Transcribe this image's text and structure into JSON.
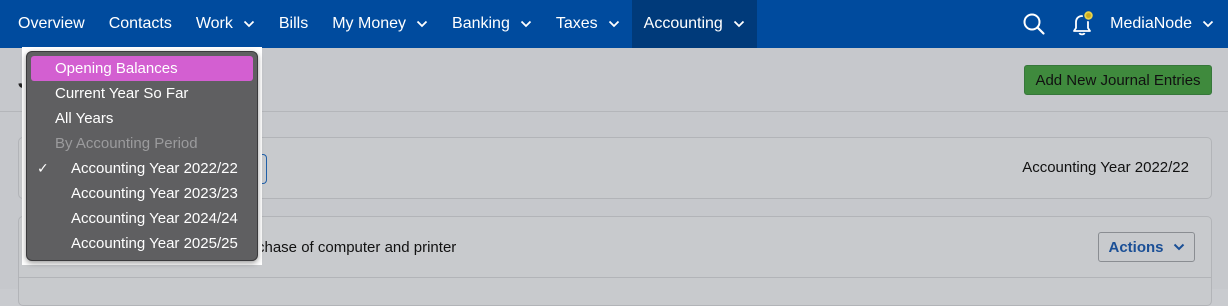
{
  "nav": {
    "items": [
      {
        "label": "Overview",
        "has_caret": false
      },
      {
        "label": "Contacts",
        "has_caret": false
      },
      {
        "label": "Work",
        "has_caret": true
      },
      {
        "label": "Bills",
        "has_caret": false
      },
      {
        "label": "My Money",
        "has_caret": true
      },
      {
        "label": "Banking",
        "has_caret": true
      },
      {
        "label": "Taxes",
        "has_caret": true
      },
      {
        "label": "Accounting",
        "has_caret": true,
        "active": true
      }
    ],
    "search_icon": "search-icon",
    "notification_icon": "bell-icon",
    "user_label": "MediaNode"
  },
  "page": {
    "title_fragment": "J",
    "add_button_label": "Add New Journal Entries",
    "period_display": "Accounting Year 2022/22",
    "entry_description_fragment": "chase of computer and printer",
    "actions_label": "Actions"
  },
  "menu": {
    "items": [
      {
        "label": "Opening Balances",
        "selected": true
      },
      {
        "label": "Current Year So Far"
      },
      {
        "label": "All Years"
      },
      {
        "label": "By Accounting Period",
        "disabled": true
      },
      {
        "label": "Accounting Year 2022/22",
        "checked": true,
        "indent": true
      },
      {
        "label": "Accounting Year 2023/23",
        "indent": true
      },
      {
        "label": "Accounting Year 2024/24",
        "indent": true
      },
      {
        "label": "Accounting Year 2025/25",
        "indent": true
      }
    ],
    "check_glyph": "✓"
  },
  "colors": {
    "nav_bg": "#004b9e",
    "nav_active": "#003a7a",
    "menu_highlight": "#d35fd1",
    "add_button": "#3f8a3d"
  }
}
